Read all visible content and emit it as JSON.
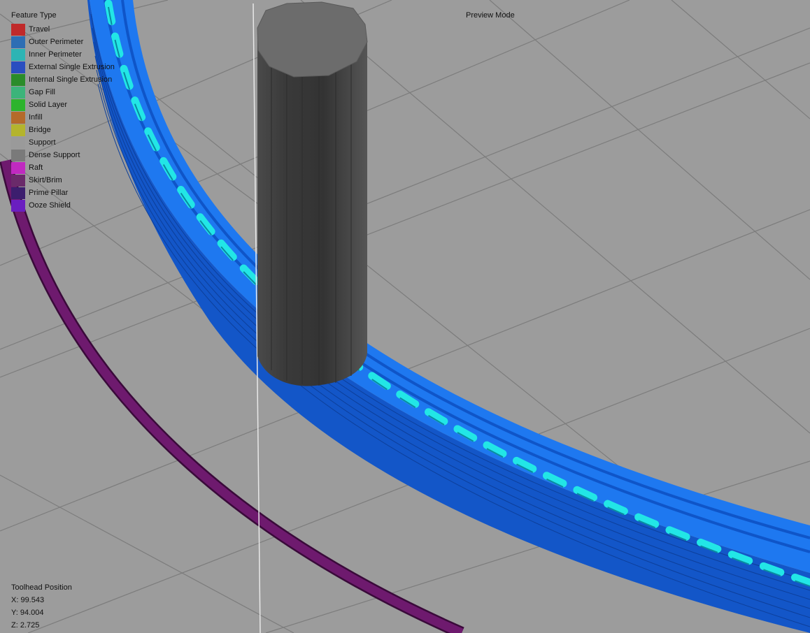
{
  "legend": {
    "title": "Feature Type",
    "items": [
      {
        "label": "Travel",
        "color": "#c02a2a"
      },
      {
        "label": "Outer Perimeter",
        "color": "#2d6eb4"
      },
      {
        "label": "Inner Perimeter",
        "color": "#2db4b4"
      },
      {
        "label": "External Single Extrusion",
        "color": "#2a4ec0"
      },
      {
        "label": "Internal Single Extrusion",
        "color": "#2a8c2a"
      },
      {
        "label": "Gap Fill",
        "color": "#3cb47a"
      },
      {
        "label": "Solid Layer",
        "color": "#2db42d"
      },
      {
        "label": "Infill",
        "color": "#b46a2a"
      },
      {
        "label": "Bridge",
        "color": "#b4b42d"
      },
      {
        "label": "Support",
        "color": "#9a9a9a"
      },
      {
        "label": "Dense Support",
        "color": "#7a7a7a"
      },
      {
        "label": "Raft",
        "color": "#c02ac0"
      },
      {
        "label": "Skirt/Brim",
        "color": "#6a2a6a"
      },
      {
        "label": "Prime Pillar",
        "color": "#3c1e6e"
      },
      {
        "label": "Ooze Shield",
        "color": "#6a1ec0"
      }
    ]
  },
  "mode_label": "Preview Mode",
  "toolhead": {
    "title": "Toolhead Position",
    "x": "X: 99.543",
    "y": "Y: 94.004",
    "z": "Z: 2.725"
  }
}
